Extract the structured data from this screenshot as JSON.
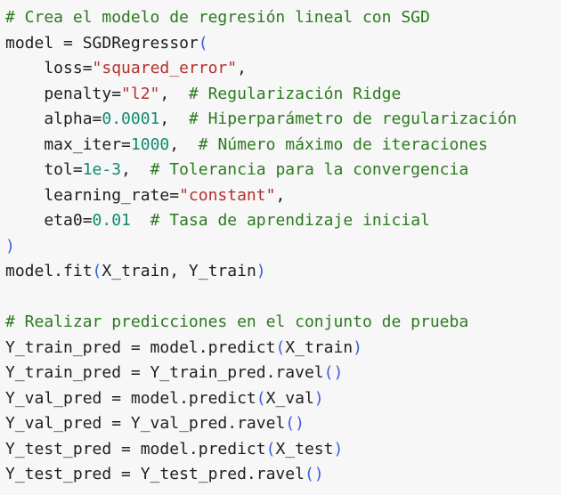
{
  "colors": {
    "background": "#f7f7f7",
    "text": "#1f1f1f",
    "comment": "#2b7a1e",
    "string": "#b2302c",
    "number": "#0e8a71",
    "bracket": "#3b5bdb"
  },
  "lines": [
    [
      {
        "t": "cm",
        "v": "# Crea el modelo de regresión lineal con SGD"
      }
    ],
    [
      {
        "t": "tx",
        "v": "model = SGDRegressor"
      },
      {
        "t": "br",
        "v": "("
      }
    ],
    [
      {
        "t": "tx",
        "v": "    loss="
      },
      {
        "t": "st",
        "v": "\"squared_error\""
      },
      {
        "t": "tx",
        "v": ","
      }
    ],
    [
      {
        "t": "tx",
        "v": "    penalty="
      },
      {
        "t": "st",
        "v": "\"l2\""
      },
      {
        "t": "tx",
        "v": ",  "
      },
      {
        "t": "cm",
        "v": "# Regularización Ridge"
      }
    ],
    [
      {
        "t": "tx",
        "v": "    alpha="
      },
      {
        "t": "nu",
        "v": "0.0001"
      },
      {
        "t": "tx",
        "v": ",  "
      },
      {
        "t": "cm",
        "v": "# Hiperparámetro de regularización"
      }
    ],
    [
      {
        "t": "tx",
        "v": "    max_iter="
      },
      {
        "t": "nu",
        "v": "1000"
      },
      {
        "t": "tx",
        "v": ",  "
      },
      {
        "t": "cm",
        "v": "# Número máximo de iteraciones"
      }
    ],
    [
      {
        "t": "tx",
        "v": "    tol="
      },
      {
        "t": "nu",
        "v": "1e-3"
      },
      {
        "t": "tx",
        "v": ",  "
      },
      {
        "t": "cm",
        "v": "# Tolerancia para la convergencia"
      }
    ],
    [
      {
        "t": "tx",
        "v": "    learning_rate="
      },
      {
        "t": "st",
        "v": "\"constant\""
      },
      {
        "t": "tx",
        "v": ","
      }
    ],
    [
      {
        "t": "tx",
        "v": "    eta0="
      },
      {
        "t": "nu",
        "v": "0.01"
      },
      {
        "t": "tx",
        "v": "  "
      },
      {
        "t": "cm",
        "v": "# Tasa de aprendizaje inicial"
      }
    ],
    [
      {
        "t": "br",
        "v": ")"
      }
    ],
    [
      {
        "t": "tx",
        "v": "model.fit"
      },
      {
        "t": "br",
        "v": "("
      },
      {
        "t": "tx",
        "v": "X_train, Y_train"
      },
      {
        "t": "br",
        "v": ")"
      }
    ],
    [
      {
        "t": "tx",
        "v": ""
      }
    ],
    [
      {
        "t": "cm",
        "v": "# Realizar predicciones en el conjunto de prueba"
      }
    ],
    [
      {
        "t": "tx",
        "v": "Y_train_pred = model.predict"
      },
      {
        "t": "br",
        "v": "("
      },
      {
        "t": "tx",
        "v": "X_train"
      },
      {
        "t": "br",
        "v": ")"
      }
    ],
    [
      {
        "t": "tx",
        "v": "Y_train_pred = Y_train_pred.ravel"
      },
      {
        "t": "br",
        "v": "()"
      }
    ],
    [
      {
        "t": "tx",
        "v": "Y_val_pred = model.predict"
      },
      {
        "t": "br",
        "v": "("
      },
      {
        "t": "tx",
        "v": "X_val"
      },
      {
        "t": "br",
        "v": ")"
      }
    ],
    [
      {
        "t": "tx",
        "v": "Y_val_pred = Y_val_pred.ravel"
      },
      {
        "t": "br",
        "v": "()"
      }
    ],
    [
      {
        "t": "tx",
        "v": "Y_test_pred = model.predict"
      },
      {
        "t": "br",
        "v": "("
      },
      {
        "t": "tx",
        "v": "X_test"
      },
      {
        "t": "br",
        "v": ")"
      }
    ],
    [
      {
        "t": "tx",
        "v": "Y_test_pred = Y_test_pred.ravel"
      },
      {
        "t": "br",
        "v": "()"
      }
    ]
  ]
}
